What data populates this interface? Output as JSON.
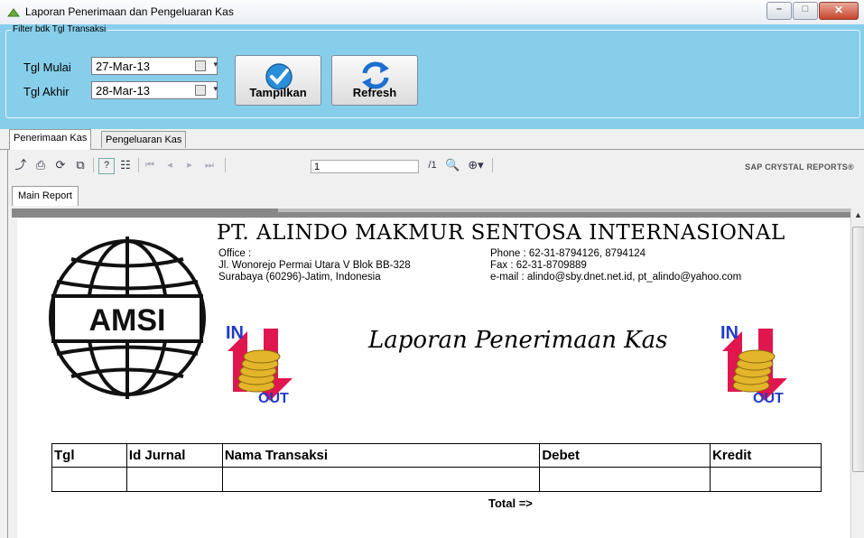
{
  "window": {
    "title": "Laporan Penerimaan dan Pengeluaran Kas",
    "minimize_glyph": "–",
    "maximize_glyph": "□",
    "close_glyph": "✕"
  },
  "filter": {
    "group_title": "Filter bdk Tgl Transaksi",
    "start_label": "Tgl Mulai",
    "start_value": "27-Mar-13",
    "end_label": "Tgl Akhir",
    "end_value": "28-Mar-13",
    "show_button": "Tampilkan",
    "refresh_button": "Refresh"
  },
  "tabs": [
    {
      "label": "Penerimaan Kas",
      "active": true
    },
    {
      "label": "Pengeluaran Kas",
      "active": false
    }
  ],
  "viewer": {
    "page_number": "1",
    "page_total": "/1",
    "brand": "SAP CRYSTAL REPORTS®",
    "main_tab": "Main Report"
  },
  "report": {
    "company": "PT. ALINDO MAKMUR SENTOSA INTERNASIONAL",
    "logo_text": "AMSI",
    "office_label": "Office :",
    "address_line1": "Jl. Wonorejo Permai Utara V Blok BB-328",
    "address_line2": "Surabaya (60296)-Jatim, Indonesia",
    "phone": "Phone : 62-31-8794126, 8794124",
    "fax": "Fax    : 62-31-8709889",
    "email": "e-mail  : alindo@sby.dnet.net.id, pt_alindo@yahoo.com",
    "in_label": "IN",
    "out_label": "OUT",
    "title": "Laporan Penerimaan Kas",
    "columns": [
      "Tgl",
      "Id Jurnal",
      "Nama Transaksi",
      "Debet",
      "Kredit"
    ],
    "total_label": "Total =>"
  },
  "colors": {
    "filter_bg": "#87ceeb",
    "close_button": "#c8452c"
  }
}
